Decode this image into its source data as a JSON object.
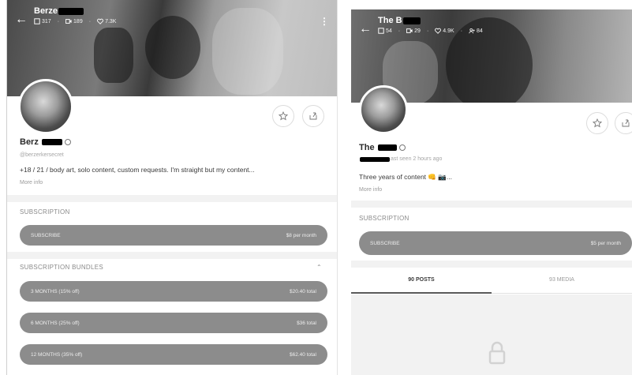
{
  "left": {
    "cover": {
      "name": "Berze",
      "posts": "317",
      "videos": "189",
      "likes": "7.3K"
    },
    "profile": {
      "name": "Berz",
      "handle": "@berzerkersecret",
      "bio": "+18 / 21 / body art, solo content, custom requests. I'm straight but my content...",
      "more_info": "More info"
    },
    "subscription": {
      "label": "SUBSCRIPTION",
      "button_label": "SUBSCRIBE",
      "price": "$8 per month"
    },
    "bundles": {
      "label": "SUBSCRIPTION BUNDLES",
      "items": [
        {
          "label": "3 MONTHS (15% off)",
          "price": "$20.40 total"
        },
        {
          "label": "6 MONTHS (25% off)",
          "price": "$36 total"
        },
        {
          "label": "12 MONTHS (35% off)",
          "price": "$62.40 total"
        }
      ]
    }
  },
  "right": {
    "cover": {
      "name": "The B",
      "posts": "54",
      "videos": "29",
      "likes": "4.9K",
      "subscribers": "84"
    },
    "profile": {
      "name": "The",
      "last_seen": "ast seen 2 hours ago",
      "bio": "Three years of content 👊 📷...",
      "more_info": "More info"
    },
    "subscription": {
      "label": "SUBSCRIPTION",
      "button_label": "SUBSCRIBE",
      "price": "$5 per month"
    },
    "tabs": [
      {
        "label": "90 POSTS",
        "active": true
      },
      {
        "label": "93 MEDIA",
        "active": false
      }
    ]
  },
  "colors": {
    "pill": "#8c8c8c",
    "separator": "#f2f2f2",
    "text_muted": "#8a8a8a"
  },
  "icons": [
    "back-arrow-icon",
    "post-icon",
    "video-icon",
    "heart-icon",
    "subscribers-icon",
    "more-vertical-icon",
    "star-icon",
    "share-icon",
    "verified-icon",
    "lock-icon",
    "chevron-up-icon"
  ]
}
